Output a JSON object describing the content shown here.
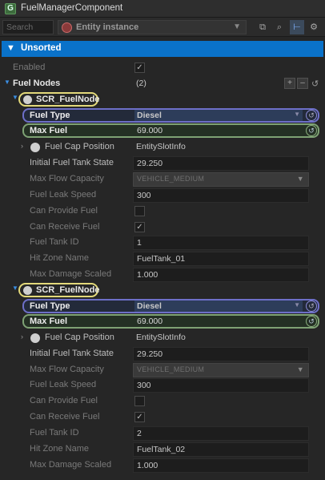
{
  "window": {
    "title": "FuelManagerComponent",
    "icon": "G"
  },
  "toolbar": {
    "search_placeholder": "Search",
    "entity_label": "Entity instance"
  },
  "section": {
    "label": "Unsorted"
  },
  "rows": {
    "enabled": {
      "label": "Enabled",
      "checked": "✓"
    },
    "fuel_nodes": {
      "label": "Fuel Nodes",
      "value": "(2)",
      "add": "+",
      "remove": "–"
    }
  },
  "nodes": [
    {
      "name": "SCR_FuelNode",
      "fuel_type": {
        "label": "Fuel Type",
        "value": "Diesel"
      },
      "max_fuel": {
        "label": "Max Fuel",
        "value": "69.000"
      },
      "fuel_cap_position": {
        "label": "Fuel Cap Position",
        "value": "EntitySlotInfo"
      },
      "initial_fuel": {
        "label": "Initial Fuel Tank State",
        "value": "29.250"
      },
      "max_flow": {
        "label": "Max Flow Capacity",
        "value": "VEHICLE_MEDIUM"
      },
      "leak_speed": {
        "label": "Fuel Leak Speed",
        "value": "300"
      },
      "can_provide": {
        "label": "Can Provide Fuel",
        "checked": ""
      },
      "can_receive": {
        "label": "Can Receive Fuel",
        "checked": "✓"
      },
      "tank_id": {
        "label": "Fuel Tank ID",
        "value": "1"
      },
      "hit_zone": {
        "label": "Hit Zone Name",
        "value": "FuelTank_01"
      },
      "max_damage": {
        "label": "Max Damage Scaled",
        "value": "1.000"
      }
    },
    {
      "name": "SCR_FuelNode",
      "fuel_type": {
        "label": "Fuel Type",
        "value": "Diesel"
      },
      "max_fuel": {
        "label": "Max Fuel",
        "value": "69.000"
      },
      "fuel_cap_position": {
        "label": "Fuel Cap Position",
        "value": "EntitySlotInfo"
      },
      "initial_fuel": {
        "label": "Initial Fuel Tank State",
        "value": "29.250"
      },
      "max_flow": {
        "label": "Max Flow Capacity",
        "value": "VEHICLE_MEDIUM"
      },
      "leak_speed": {
        "label": "Fuel Leak Speed",
        "value": "300"
      },
      "can_provide": {
        "label": "Can Provide Fuel",
        "checked": ""
      },
      "can_receive": {
        "label": "Can Receive Fuel",
        "checked": "✓"
      },
      "tank_id": {
        "label": "Fuel Tank ID",
        "value": "2"
      },
      "hit_zone": {
        "label": "Hit Zone Name",
        "value": "FuelTank_02"
      },
      "max_damage": {
        "label": "Max Damage Scaled",
        "value": "1.000"
      }
    }
  ],
  "colors": {
    "section_header": "#0a72c9",
    "node_outline": "#e3d97a",
    "fuel_type_outline": "#6d6fc8",
    "max_fuel_outline": "#7ea274"
  }
}
